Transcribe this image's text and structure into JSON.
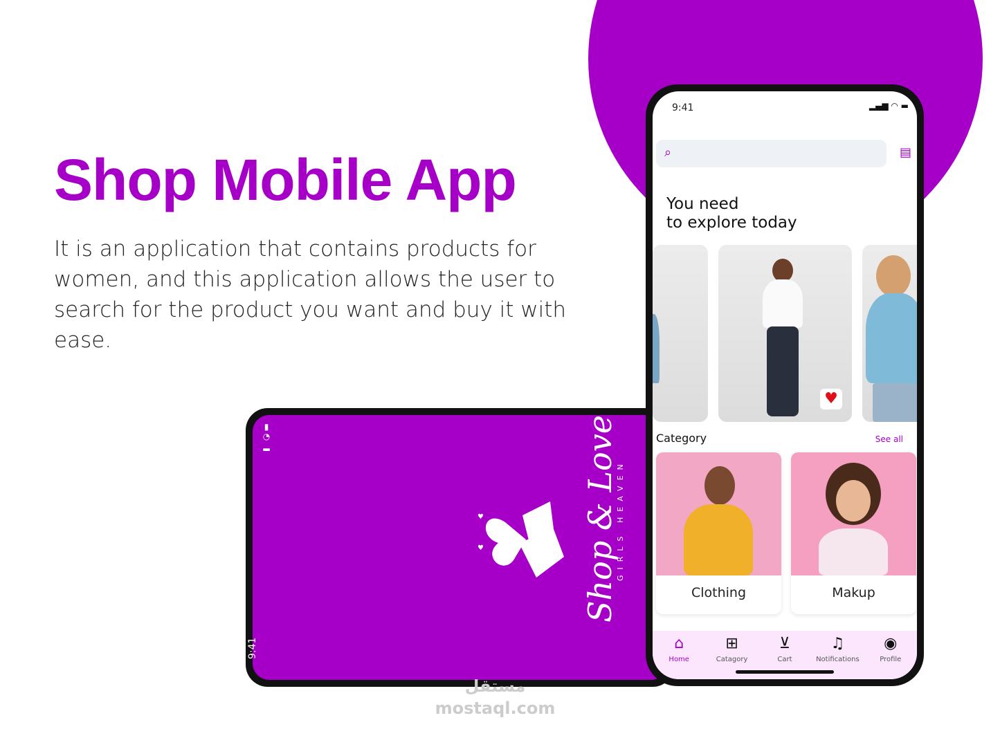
{
  "hero": {
    "title": "Shop Mobile App",
    "description": "It is an application that contains products for women, and this application allows the user to search for the product you want and buy it with ease."
  },
  "colors": {
    "brand": "#a600c8",
    "nav_bg": "#fbe6fd",
    "heart": "#e0101a"
  },
  "splash": {
    "time": "9:41",
    "brand_name": "Shop & Love",
    "tagline": "GIRLS HEAVEN"
  },
  "app": {
    "status_time": "9:41",
    "search_placeholder": "",
    "heading_line1": "You need",
    "heading_line2": "to explore today",
    "category_title": "Category",
    "see_all": "See all",
    "categories": [
      {
        "label": "Clothing"
      },
      {
        "label": "Makup"
      }
    ],
    "nav": [
      {
        "label": "Home",
        "icon": "home-icon"
      },
      {
        "label": "Catagory",
        "icon": "grid-icon"
      },
      {
        "label": "Cart",
        "icon": "cart-icon"
      },
      {
        "label": "Notifications",
        "icon": "bell-icon"
      },
      {
        "label": "Profile",
        "icon": "profile-icon"
      }
    ]
  },
  "watermark": {
    "arabic": "مستقل",
    "latin": "mostaql.com"
  }
}
